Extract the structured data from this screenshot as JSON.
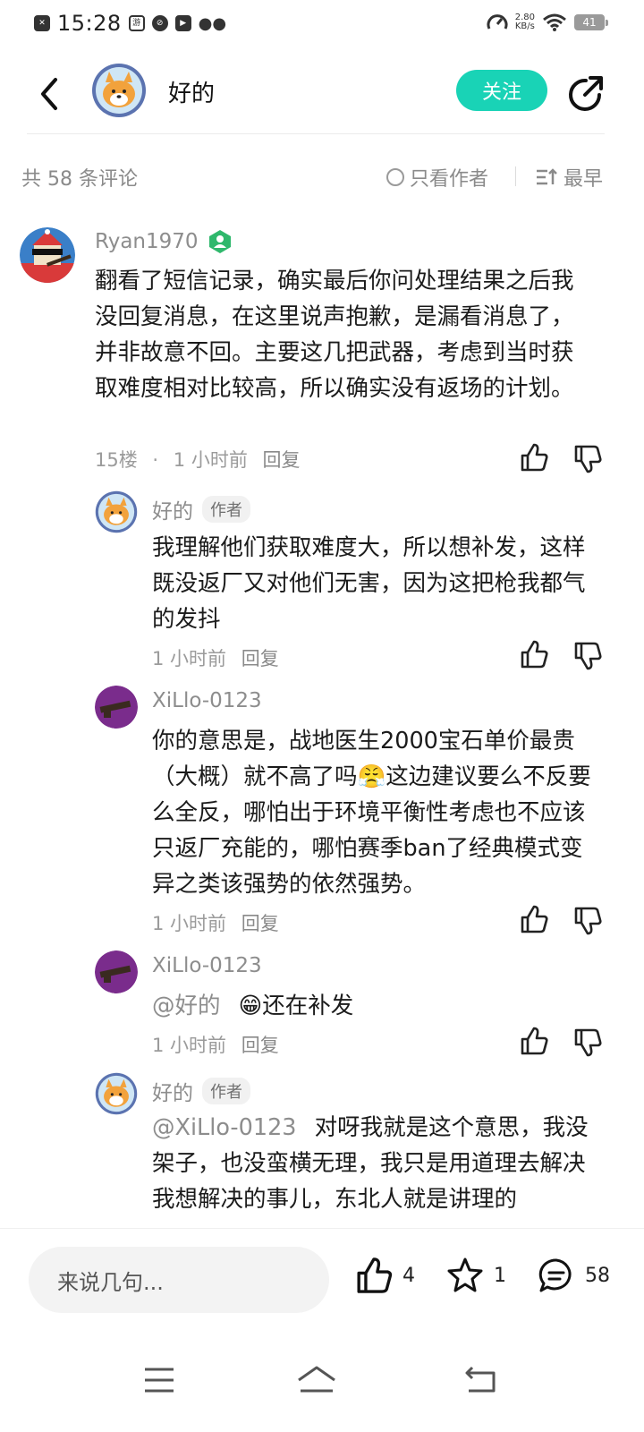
{
  "status_bar": {
    "time": "15:28",
    "speed_value": "2.80",
    "speed_unit": "KB/s",
    "battery": "41",
    "icons": [
      "close-box-icon",
      "game-center-icon",
      "swirl-app-icon",
      "video-app-icon",
      "wechat-icon"
    ]
  },
  "header": {
    "title": "好的",
    "follow_label": "关注",
    "share_icon": "share-icon",
    "back_icon": "back-arrow-icon"
  },
  "filter": {
    "count_label": "共 58 条评论",
    "only_author_label": "只看作者",
    "sort_label": "最早"
  },
  "comments": [
    {
      "username": "Ryan1970",
      "text": "翻看了短信记录，确实最后你问处理结果之后我没回复消息，在这里说声抱歉，是漏看消息了，并非故意不回。主要这几把武器，考虑到当时获取难度相对比较高，所以确实没有返场的计划。",
      "floor": "15楼",
      "sep": "·",
      "time": "1 小时前",
      "reply": "回复"
    }
  ],
  "replies": [
    {
      "username": "好的",
      "tag": "作者",
      "text": "我理解他们获取难度大，所以想补发，这样既没返厂又对他们无害，因为这把枪我都气的发抖",
      "time": "1 小时前",
      "reply": "回复"
    },
    {
      "username": "XiLlo-0123",
      "text": "你的意思是，战地医生2000宝石单价最贵（大概）就不高了吗😤这边建议要么不反要么全反，哪怕出于环境平衡性考虑也不应该只返厂充能的，哪怕赛季ban了经典模式变异之类该强势的依然强势。",
      "time": "1 小时前",
      "reply": "回复"
    },
    {
      "username": "XiLlo-0123",
      "mention": "@好的",
      "text": "😁还在补发",
      "time": "1 小时前",
      "reply": "回复"
    },
    {
      "username": "好的",
      "tag": "作者",
      "mention": "@XiLlo-0123",
      "text": "对呀我就是这个意思，我没架子，也没蛮横无理，我只是用道理去解决我想解决的事儿，东北人就是讲理的",
      "time": "",
      "reply": ""
    }
  ],
  "bottom_bar": {
    "input_placeholder": "来说几句...",
    "like_count": "4",
    "star_count": "1",
    "comment_count": "58"
  },
  "colors": {
    "accent": "#19d3b6",
    "muted_text": "#8d8d8d",
    "body_text": "#1b1b1b"
  }
}
